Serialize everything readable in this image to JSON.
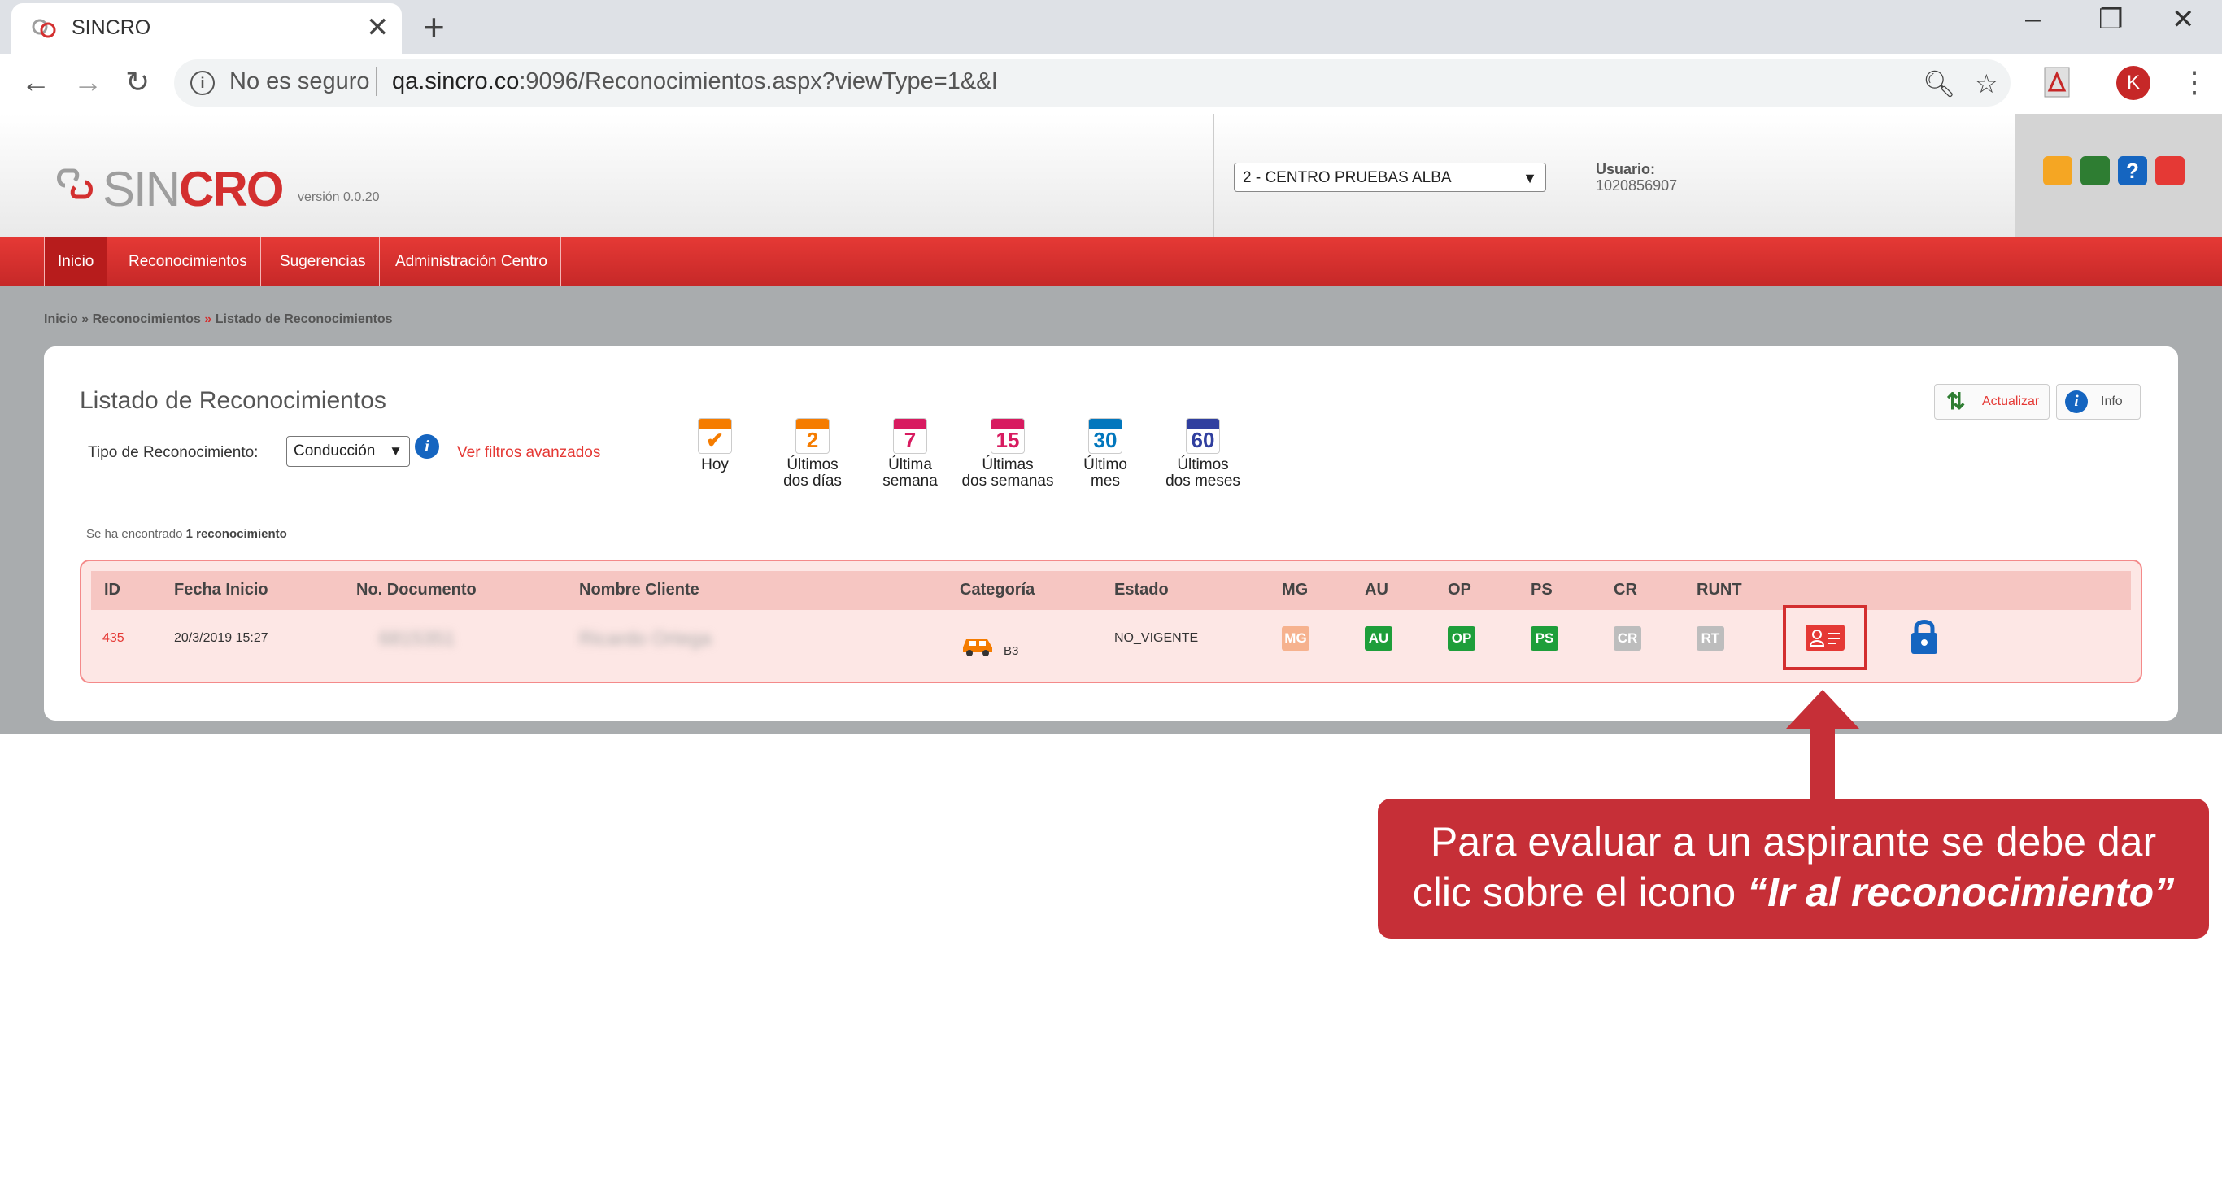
{
  "browser": {
    "tab_title": "SINCRO",
    "close_glyph": "✕",
    "new_tab_glyph": "+",
    "security_text": "No es seguro",
    "url_host": "qa.sincro.co",
    "url_rest": ":9096/Reconocimientos.aspx?viewType=1&&l",
    "profile_initial": "K",
    "icons": [
      "back-icon",
      "forward-icon",
      "reload-icon",
      "zoom-icon",
      "star-icon",
      "pdf-extension-icon",
      "menu-icon",
      "minimize-icon",
      "restore-icon",
      "close-icon"
    ]
  },
  "header": {
    "logo_sin": "SIN",
    "logo_cro": "CRO",
    "version": "versión 0.0.20",
    "center_selected": "2 - CENTRO PRUEBAS ALBA",
    "user_label": "Usuario:",
    "user_id": "1020856907",
    "tool_colors": [
      "#f5a623",
      "#2e7d32",
      "#1565c0",
      "#e53935"
    ]
  },
  "menu": [
    "Inicio",
    "Reconocimientos",
    "Sugerencias",
    "Administración Centro"
  ],
  "breadcrumb": {
    "home": "Inicio",
    "sep1": "»",
    "level1": "Reconocimientos",
    "sep2": "»",
    "current": "Listado de Reconocimientos"
  },
  "page": {
    "title": "Listado de Reconocimientos",
    "tipo_label": "Tipo de Reconocimiento:",
    "tipo_value": "Conducción",
    "filtros_link": "Ver filtros avanzados",
    "actualizar": "Actualizar",
    "info": "Info",
    "found_prefix": "Se ha encontrado ",
    "found_count": "1 reconocimiento"
  },
  "calendars": [
    {
      "num": "✔",
      "line1": "Hoy",
      "line2": "",
      "color": "#f57c00"
    },
    {
      "num": "2",
      "line1": "Últimos",
      "line2": "dos días",
      "color": "#f57c00"
    },
    {
      "num": "7",
      "line1": "Última",
      "line2": "semana",
      "color": "#d81b60"
    },
    {
      "num": "15",
      "line1": "Últimas",
      "line2": "dos semanas",
      "color": "#d81b60"
    },
    {
      "num": "30",
      "line1": "Último",
      "line2": "mes",
      "color": "#0277bd"
    },
    {
      "num": "60",
      "line1": "Últimos",
      "line2": "dos meses",
      "color": "#303f9f"
    }
  ],
  "table": {
    "headers": [
      "ID",
      "Fecha Inicio",
      "No. Documento",
      "Nombre Cliente",
      "Categoría",
      "Estado",
      "MG",
      "AU",
      "OP",
      "PS",
      "CR",
      "RUNT"
    ],
    "row": {
      "id": "435",
      "fecha": "20/3/2019 15:27",
      "documento": "6815351",
      "cliente": "Ricardo Ortega",
      "categoria": "B3",
      "estado": "NO_VIGENTE",
      "badges": [
        {
          "label": "MG",
          "color": "#f6b28e"
        },
        {
          "label": "AU",
          "color": "#1e9e3a"
        },
        {
          "label": "OP",
          "color": "#1e9e3a"
        },
        {
          "label": "PS",
          "color": "#1e9e3a"
        },
        {
          "label": "CR",
          "color": "#bdbdbd"
        },
        {
          "label": "RT",
          "color": "#bdbdbd"
        }
      ]
    }
  },
  "callout": {
    "line1": "Para evaluar a un aspirante se debe dar",
    "line2_prefix": "clic sobre el icono ",
    "line2_emphasis": "“Ir al reconocimiento”"
  }
}
